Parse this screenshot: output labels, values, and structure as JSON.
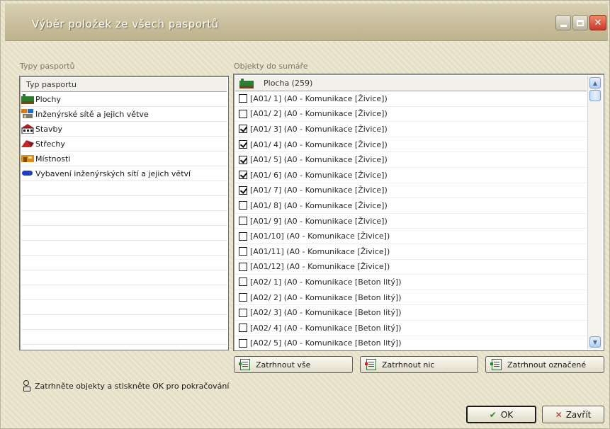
{
  "window": {
    "title": "Výběr položek ze všech pasportů",
    "controls": [
      "minimize",
      "maximize",
      "close"
    ]
  },
  "left": {
    "section_label": "Typy pasportů",
    "column_header": "Typ pasportu",
    "items": [
      {
        "label": "Plochy",
        "icon": "plochy-icon",
        "selected": true
      },
      {
        "label": "Inženýrské sítě a jejich větve",
        "icon": "inzenyrske-site-icon"
      },
      {
        "label": "Stavby",
        "icon": "stavby-icon"
      },
      {
        "label": "Střechy",
        "icon": "strechy-icon"
      },
      {
        "label": "Místnosti",
        "icon": "mistnosti-icon"
      },
      {
        "label": "Vybavení inženýrských sítí a jejich větví",
        "icon": "vybaveni-icon"
      }
    ],
    "empty_rows": 12
  },
  "right": {
    "section_label": "Objekty do sumáře",
    "header": "Plocha (259)",
    "rows": [
      {
        "label": "[A01/ 1]  (A0 - Komunikace [Živice])",
        "checked": false
      },
      {
        "label": "[A01/ 2]  (A0 - Komunikace [Živice])",
        "checked": false
      },
      {
        "label": "[A01/ 3]  (A0 - Komunikace [Živice])",
        "checked": true
      },
      {
        "label": "[A01/ 4]  (A0 - Komunikace [Živice])",
        "checked": true
      },
      {
        "label": "[A01/ 5]  (A0 - Komunikace [Živice])",
        "checked": true
      },
      {
        "label": "[A01/ 6]  (A0 - Komunikace [Živice])",
        "checked": true
      },
      {
        "label": "[A01/ 7]  (A0 - Komunikace [Živice])",
        "checked": true
      },
      {
        "label": "[A01/ 8]  (A0 - Komunikace [Živice])",
        "checked": false
      },
      {
        "label": "[A01/ 9]  (A0 - Komunikace [Živice])",
        "checked": false
      },
      {
        "label": "[A01/10]  (A0 - Komunikace [Živice])",
        "checked": false
      },
      {
        "label": "[A01/11]  (A0 - Komunikace [Živice])",
        "checked": false
      },
      {
        "label": "[A01/12]  (A0 - Komunikace [Živice])",
        "checked": false
      },
      {
        "label": "[A02/ 1]  (A0 - Komunikace [Beton litý])",
        "checked": false
      },
      {
        "label": "[A02/ 2]  (A0 - Komunikace [Beton litý])",
        "checked": false
      },
      {
        "label": "[A02/ 3]  (A0 - Komunikace [Beton litý])",
        "checked": false
      },
      {
        "label": "[A02/ 4]  (A0 - Komunikace [Beton litý])",
        "checked": false
      },
      {
        "label": "[A02/ 5]  (A0 - Komunikace [Beton litý])",
        "checked": false
      }
    ]
  },
  "buttons": {
    "select_all": "Zatrhnout vše",
    "select_none": "Zatrhnout nic",
    "select_marked": "Zatrhnout označené",
    "ok": "OK",
    "close": "Zavřít"
  },
  "hint": "Zatrhněte objekty a stiskněte OK pro pokračování",
  "colors": {
    "accent_red": "#c9382a",
    "plochy_green": "#2e7d32",
    "vybaveni_blue": "#1f3fbf"
  }
}
